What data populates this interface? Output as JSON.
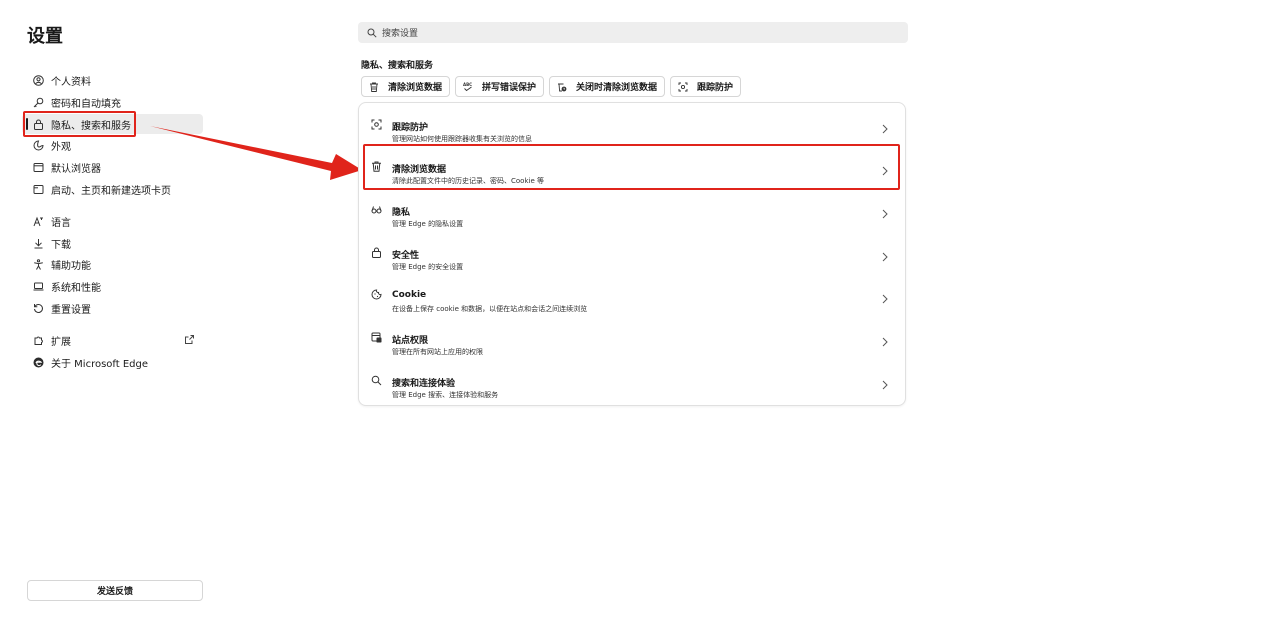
{
  "sidebar": {
    "title": "设置",
    "items": [
      {
        "label": "个人资料",
        "icon": "profile-icon"
      },
      {
        "label": "密码和自动填充",
        "icon": "key-icon"
      },
      {
        "label": "隐私、搜索和服务",
        "icon": "lock-icon"
      },
      {
        "label": "外观",
        "icon": "appearance-icon"
      },
      {
        "label": "默认浏览器",
        "icon": "browser-icon"
      },
      {
        "label": "启动、主页和新建选项卡页",
        "icon": "home-tab-icon"
      },
      {
        "label": "语言",
        "icon": "language-icon"
      },
      {
        "label": "下载",
        "icon": "download-icon"
      },
      {
        "label": "辅助功能",
        "icon": "accessibility-icon"
      },
      {
        "label": "系统和性能",
        "icon": "laptop-icon"
      },
      {
        "label": "重置设置",
        "icon": "reset-icon"
      },
      {
        "label": "扩展",
        "icon": "puzzle-icon"
      },
      {
        "label": "关于 Microsoft Edge",
        "icon": "edge-logo-icon"
      }
    ],
    "feedback_label": "发送反馈"
  },
  "search": {
    "placeholder": "搜索设置"
  },
  "section": {
    "title": "隐私、搜索和服务",
    "chips": [
      {
        "label": "清除浏览数据",
        "icon": "trash-icon"
      },
      {
        "label": "拼写错误保护",
        "icon": "spellcheck-icon"
      },
      {
        "label": "关闭时清除浏览数据",
        "icon": "trash-clock-icon"
      },
      {
        "label": "跟踪防护",
        "icon": "tracking-icon"
      }
    ],
    "rows": [
      {
        "title": "跟踪防护",
        "desc": "管理网站如何使用跟踪器收集有关浏览的信息",
        "icon": "tracking-icon"
      },
      {
        "title": "清除浏览数据",
        "desc": "清除此配置文件中的历史记录、密码、Cookie 等",
        "icon": "trash-icon"
      },
      {
        "title": "隐私",
        "desc": "管理 Edge 的隐私设置",
        "icon": "glasses-icon"
      },
      {
        "title": "安全性",
        "desc": "管理 Edge 的安全设置",
        "icon": "lock-icon"
      },
      {
        "title": "Cookie",
        "desc": "在设备上保存 cookie 和数据，以便在站点和会话之间连续浏览",
        "icon": "cookie-icon"
      },
      {
        "title": "站点权限",
        "desc": "管理在所有网站上应用的权限",
        "icon": "site-permissions-icon"
      },
      {
        "title": "搜索和连接体验",
        "desc": "管理 Edge 搜索、连接体验和服务",
        "icon": "search-icon"
      }
    ]
  },
  "annotation": {
    "color": "#e0241b"
  }
}
